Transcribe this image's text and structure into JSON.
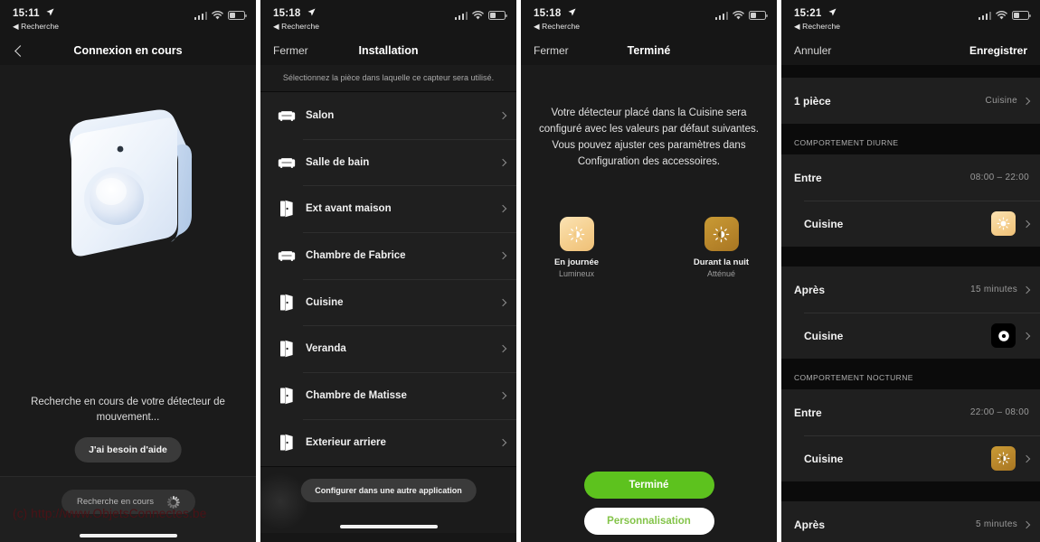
{
  "panel1": {
    "status": {
      "time": "15:11",
      "back_label": "Recherche",
      "location_icon": "location-arrow-icon"
    },
    "nav": {
      "title": "Connexion en cours",
      "back_icon": "chevron-left-icon"
    },
    "device_image_name": "motion-sensor-3d-render",
    "caption": "Recherche en cours de votre détecteur de mouvement...",
    "help_button": "J'ai besoin d'aide",
    "search_pill": "Recherche en cours",
    "watermark": "(c) http://www.ObjetsConnectes.be"
  },
  "panel2": {
    "status": {
      "time": "15:18",
      "back_label": "Recherche"
    },
    "nav": {
      "left": "Fermer",
      "title": "Installation"
    },
    "subtitle": "Sélectionnez la pièce dans laquelle ce capteur sera utilisé.",
    "rooms": [
      {
        "label": "Salon",
        "icon": "sofa-icon"
      },
      {
        "label": "Salle de bain",
        "icon": "sofa-icon"
      },
      {
        "label": "Ext avant maison",
        "icon": "door-icon"
      },
      {
        "label": "Chambre de Fabrice",
        "icon": "sofa-icon"
      },
      {
        "label": "Cuisine",
        "icon": "door-icon"
      },
      {
        "label": "Veranda",
        "icon": "door-icon"
      },
      {
        "label": "Chambre de Matisse",
        "icon": "door-icon"
      },
      {
        "label": "Exterieur arriere",
        "icon": "door-icon"
      }
    ],
    "alt_app_button": "Configurer dans une autre application"
  },
  "panel3": {
    "status": {
      "time": "15:18",
      "back_label": "Recherche"
    },
    "nav": {
      "left": "Fermer",
      "title": "Terminé"
    },
    "description": "Votre détecteur placé dans la Cuisine sera configuré avec les valeurs par défaut suivantes. Vous pouvez ajuster ces paramètres dans Configuration des accessoires.",
    "modes": [
      {
        "name": "En journée",
        "sub": "Lumineux",
        "icon": "sun-bright-icon",
        "color": "#f5cf8e"
      },
      {
        "name": "Durant la nuit",
        "sub": "Atténué",
        "icon": "sun-dim-icon",
        "color": "#b8862b"
      }
    ],
    "primary_button": "Terminé",
    "secondary_button": "Personnalisation",
    "primary_color": "#5dc21e",
    "secondary_text_color": "#84c44a"
  },
  "panel4": {
    "status": {
      "time": "15:21",
      "back_label": "Recherche"
    },
    "nav": {
      "left": "Annuler",
      "right": "Enregistrer"
    },
    "room_row": {
      "key": "1 pièce",
      "value": "Cuisine"
    },
    "sections": [
      {
        "title": "COMPORTEMENT DIURNE",
        "rows": [
          {
            "key": "Entre",
            "value": "08:00 – 22:00",
            "type": "value"
          },
          {
            "key": "Cuisine",
            "swatch": "day",
            "icon": "sun-bright-icon",
            "type": "swatch"
          }
        ]
      },
      {
        "rows": [
          {
            "key": "Après",
            "value": "15 minutes",
            "type": "value-chev"
          },
          {
            "key": "Cuisine",
            "swatch": "off",
            "icon": "power-off-icon",
            "type": "swatch"
          }
        ]
      },
      {
        "title": "COMPORTEMENT NOCTURNE",
        "rows": [
          {
            "key": "Entre",
            "value": "22:00 – 08:00",
            "type": "value"
          },
          {
            "key": "Cuisine",
            "swatch": "night",
            "icon": "sun-dim-icon",
            "type": "swatch"
          }
        ]
      },
      {
        "rows": [
          {
            "key": "Après",
            "value": "5 minutes",
            "type": "value-chev"
          }
        ]
      }
    ]
  }
}
